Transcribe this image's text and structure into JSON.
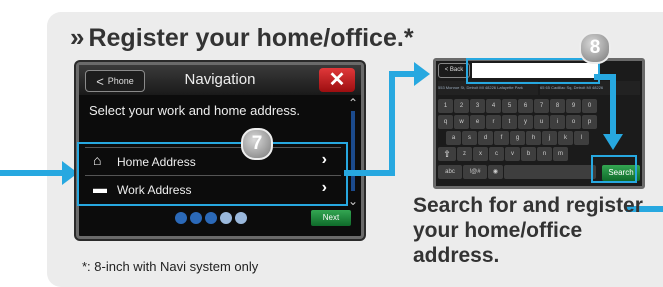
{
  "heading": {
    "chevron": "»",
    "text": "Register your home/office.*"
  },
  "nav_screen": {
    "back_label": "Phone",
    "back_arrow": "<",
    "title": "Navigation",
    "close_glyph": "✕",
    "prompt": "Select your work and home address.",
    "rows": [
      {
        "icon": "home-icon",
        "icon_glyph": "⌂",
        "label": "Home Address",
        "go_glyph": "›"
      },
      {
        "icon": "briefcase-icon",
        "icon_glyph": "▬",
        "label": "Work Address",
        "go_glyph": "›"
      }
    ],
    "scroll_up": "⌃",
    "scroll_down": "⌄",
    "page_dots": 5,
    "next_label": "Next"
  },
  "step_badges": {
    "step7": "7",
    "step8": "8"
  },
  "keyboard_screen": {
    "back_label": "< Back",
    "search_value": "",
    "suggestions": [
      "553 Monroe St, Detroit MI 48226 Lafayette Park",
      "65 65 Cadillac Sq, Detroit MI 48226"
    ],
    "rows": [
      [
        "1",
        "2",
        "3",
        "4",
        "5",
        "6",
        "7",
        "8",
        "9",
        "0"
      ],
      [
        "q",
        "w",
        "e",
        "r",
        "t",
        "y",
        "u",
        "i",
        "o",
        "p"
      ],
      [
        "a",
        "s",
        "d",
        "f",
        "g",
        "h",
        "j",
        "k",
        "l"
      ],
      [
        "⇧",
        "z",
        "x",
        "c",
        "v",
        "b",
        "n",
        "m"
      ],
      [
        "abc",
        "!@#",
        "◉"
      ]
    ],
    "search_label": "Search"
  },
  "footnote": "*: 8-inch with Navi system only",
  "description": "Search for and register your home/office address.",
  "colors": {
    "accent": "#27a8e0",
    "panel_bg": "#ececec",
    "close_red": "#c2191b",
    "next_green": "#1f8a3c"
  }
}
